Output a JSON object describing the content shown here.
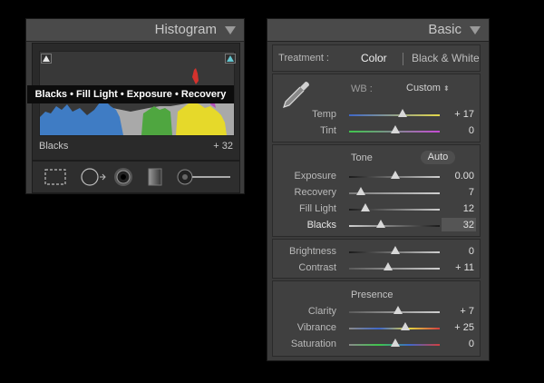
{
  "histogram": {
    "title": "Histogram",
    "tooltip": "Blacks • Fill Light • Exposure • Recovery",
    "selected_label": "Blacks",
    "selected_value": "+ 32"
  },
  "tools": [
    "crop-overlay-icon",
    "spot-removal-icon",
    "red-eye-icon",
    "graduated-filter-icon",
    "adjustment-brush-icon"
  ],
  "basic": {
    "title": "Basic",
    "treatment": {
      "label": "Treatment :",
      "color": "Color",
      "bw": "Black & White"
    },
    "wb": {
      "label": "WB :",
      "value": "Custom"
    },
    "temp": {
      "label": "Temp",
      "value": "+ 17",
      "pos": 0.53
    },
    "tint": {
      "label": "Tint",
      "value": "0",
      "pos": 0.5
    },
    "tone": {
      "title": "Tone",
      "auto": "Auto"
    },
    "exposure": {
      "label": "Exposure",
      "value": "0.00",
      "pos": 0.5
    },
    "recovery": {
      "label": "Recovery",
      "value": "7",
      "pos": 0.1
    },
    "filllight": {
      "label": "Fill Light",
      "value": "12",
      "pos": 0.16
    },
    "blacks": {
      "label": "Blacks",
      "value": "32",
      "pos": 0.32
    },
    "brightness": {
      "label": "Brightness",
      "value": "0",
      "pos": 0.5
    },
    "contrast": {
      "label": "Contrast",
      "value": "+ 11",
      "pos": 0.43
    },
    "presence": {
      "title": "Presence"
    },
    "clarity": {
      "label": "Clarity",
      "value": "+ 7",
      "pos": 0.53
    },
    "vibrance": {
      "label": "Vibrance",
      "value": "+ 25",
      "pos": 0.61
    },
    "saturation": {
      "label": "Saturation",
      "value": "0",
      "pos": 0.5
    }
  },
  "colors": {
    "panel": "#3c3c3c",
    "accent": "#65c7d1",
    "tooltip_bg": "#0c0c0c"
  }
}
